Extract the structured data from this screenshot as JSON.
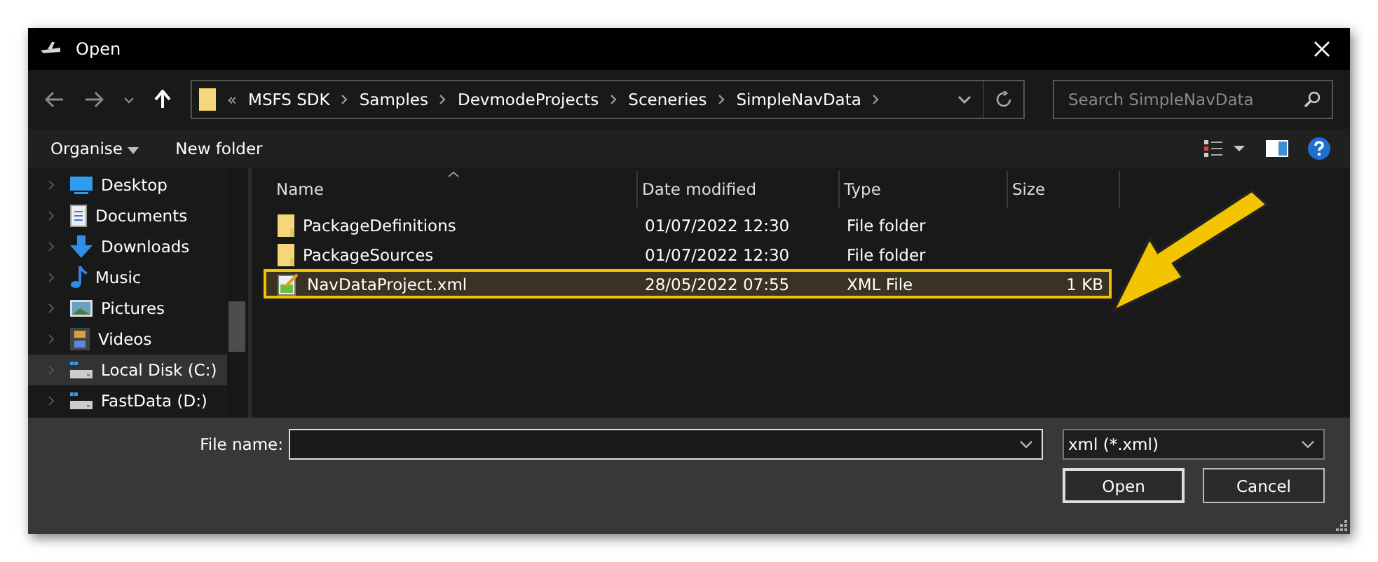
{
  "window": {
    "title": "Open"
  },
  "address": {
    "overflow": "«",
    "crumbs": [
      "MSFS SDK",
      "Samples",
      "DevmodeProjects",
      "Sceneries",
      "SimpleNavData"
    ]
  },
  "search": {
    "placeholder": "Search SimpleNavData"
  },
  "toolbar": {
    "organise": "Organise",
    "new_folder": "New folder"
  },
  "sidebar": {
    "items": [
      {
        "label": "Desktop",
        "kind": "desktop",
        "selected": false
      },
      {
        "label": "Documents",
        "kind": "documents",
        "selected": false
      },
      {
        "label": "Downloads",
        "kind": "downloads",
        "selected": false
      },
      {
        "label": "Music",
        "kind": "music",
        "selected": false
      },
      {
        "label": "Pictures",
        "kind": "pictures",
        "selected": false
      },
      {
        "label": "Videos",
        "kind": "videos",
        "selected": false
      },
      {
        "label": "Local Disk (C:)",
        "kind": "drive",
        "selected": true
      },
      {
        "label": "FastData (D:)",
        "kind": "drive",
        "selected": false
      }
    ]
  },
  "table": {
    "columns": [
      "Name",
      "Date modified",
      "Type",
      "Size"
    ],
    "rows": [
      {
        "name": "PackageDefinitions",
        "date": "01/07/2022 12:30",
        "type": "File folder",
        "kind": "folder",
        "selected": false
      },
      {
        "name": "PackageSources",
        "date": "01/07/2022 12:30",
        "type": "File folder",
        "kind": "folder",
        "selected": false
      },
      {
        "name": "NavDataProject.xml",
        "date": "28/05/2022 07:55",
        "type": "XML File",
        "size": "1 KB",
        "kind": "xml",
        "selected": true
      }
    ]
  },
  "footer": {
    "file_name_label": "File name:",
    "filter": "xml (*.xml)",
    "buttons": [
      "Open",
      "Cancel"
    ]
  }
}
